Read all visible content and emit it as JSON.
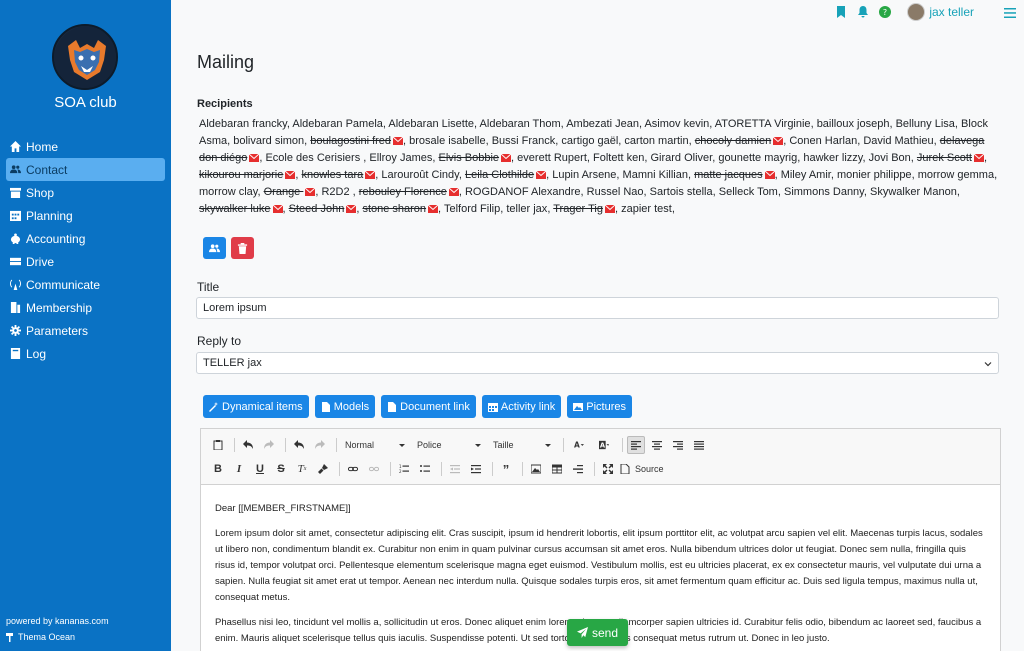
{
  "app": {
    "club_name": "SOA club",
    "powered_by": "powered by kananas.com",
    "theme": "Thema Ocean"
  },
  "sidebar": {
    "items": [
      {
        "label": "Home",
        "icon": "home-icon"
      },
      {
        "label": "Contact",
        "icon": "users-icon",
        "active": true
      },
      {
        "label": "Shop",
        "icon": "shop-icon"
      },
      {
        "label": "Planning",
        "icon": "calendar-icon"
      },
      {
        "label": "Accounting",
        "icon": "piggy-bank-icon"
      },
      {
        "label": "Drive",
        "icon": "drive-icon"
      },
      {
        "label": "Communicate",
        "icon": "broadcast-icon"
      },
      {
        "label": "Membership",
        "icon": "membership-icon"
      },
      {
        "label": "Parameters",
        "icon": "gear-icon"
      },
      {
        "label": "Log",
        "icon": "book-icon"
      }
    ]
  },
  "topbar": {
    "user_name": "jax teller"
  },
  "page": {
    "title": "Mailing"
  },
  "recipients": {
    "label": "Recipients",
    "list": [
      {
        "name": "Aldebaran francky"
      },
      {
        "name": "Aldebaran Pamela"
      },
      {
        "name": "Aldebaran Lisette"
      },
      {
        "name": "Aldebaran Thom"
      },
      {
        "name": "Ambezati Jean"
      },
      {
        "name": "Asimov kevin"
      },
      {
        "name": "ATORETTA Virginie"
      },
      {
        "name": "bailloux joseph"
      },
      {
        "name": "Belluny Lisa"
      },
      {
        "name": "Block Asma"
      },
      {
        "name": "bolivard simon"
      },
      {
        "name": "boulagostini fred",
        "invalid": true
      },
      {
        "name": "brosale isabelle"
      },
      {
        "name": "Bussi Franck"
      },
      {
        "name": "cartigo gaël"
      },
      {
        "name": "carton martin"
      },
      {
        "name": "chocoly damien",
        "invalid": true
      },
      {
        "name": "Conen Harlan"
      },
      {
        "name": "David Mathieu"
      },
      {
        "name": "delavega don diégo",
        "invalid": true
      },
      {
        "name": "Ecole des Cerisiers "
      },
      {
        "name": "Ellroy James"
      },
      {
        "name": "Elvis Bobbie",
        "invalid": true
      },
      {
        "name": "everett Rupert"
      },
      {
        "name": "Foltett ken"
      },
      {
        "name": "Girard Oliver"
      },
      {
        "name": "gounette mayrig"
      },
      {
        "name": "hawker lizzy"
      },
      {
        "name": "Jovi Bon"
      },
      {
        "name": "Jurek Scott",
        "invalid": true
      },
      {
        "name": "kikourou marjorie",
        "invalid": true
      },
      {
        "name": "knowles tara",
        "invalid": true
      },
      {
        "name": "Larouroût Cindy"
      },
      {
        "name": "Leila Clothilde",
        "invalid": true
      },
      {
        "name": "Lupin Arsene"
      },
      {
        "name": "Mamni Killian"
      },
      {
        "name": "matte jacques",
        "invalid": true
      },
      {
        "name": "Miley Amir"
      },
      {
        "name": "monier philippe"
      },
      {
        "name": "morrow gemma"
      },
      {
        "name": "morrow clay"
      },
      {
        "name": "Orange ",
        "invalid": true
      },
      {
        "name": "R2D2 "
      },
      {
        "name": "rebouley Florence",
        "invalid": true
      },
      {
        "name": "ROGDANOF Alexandre"
      },
      {
        "name": "Russel Nao"
      },
      {
        "name": "Sartois stella"
      },
      {
        "name": "Selleck Tom"
      },
      {
        "name": "Simmons Danny"
      },
      {
        "name": "Skywalker Manon"
      },
      {
        "name": "skywalker luke",
        "invalid": true
      },
      {
        "name": "Steed John",
        "invalid": true
      },
      {
        "name": "stone sharon",
        "invalid": true
      },
      {
        "name": "Telford Filip"
      },
      {
        "name": "teller jax"
      },
      {
        "name": "Trager Tig",
        "invalid": true
      },
      {
        "name": "zapier test"
      }
    ]
  },
  "form": {
    "title_label": "Title",
    "title_value": "Lorem ipsum",
    "reply_label": "Reply to",
    "reply_value": "TELLER jax"
  },
  "actions": {
    "dynamical": "Dynamical items",
    "models": "Models",
    "document_link": "Document link",
    "activity_link": "Activity link",
    "pictures": "Pictures"
  },
  "editor": {
    "format_select": "Normal",
    "font_select": "Police",
    "size_select": "Taille",
    "source_label": "Source",
    "greeting": "Dear [[MEMBER_FIRSTNAME]]",
    "paragraph1": "Lorem ipsum dolor sit amet, consectetur adipiscing elit. Cras suscipit, ipsum id hendrerit lobortis, elit ipsum porttitor elit, ac volutpat arcu sapien vel elit. Maecenas turpis lacus, sodales ut libero non, condimentum blandit ex. Curabitur non enim in quam pulvinar cursus accumsan sit amet eros. Nulla bibendum ultrices dolor ut feugiat. Donec sem nulla, fringilla quis risus id, tempor volutpat orci. Pellentesque elementum scelerisque magna eget euismod. Vestibulum mollis, est eu ultricies placerat, ex ex consectetur mauris, vel vulputate dui urna a sapien. Nulla feugiat sit amet erat ut tempor. Aenean nec interdum nulla. Quisque sodales turpis eros, sit amet fermentum quam efficitur ac. Duis sed ligula tempus, maximus nulla ut, consequat metus.",
    "paragraph2": "Phasellus nisi leo, tincidunt vel mollis a, sollicitudin ut eros. Donec aliquet enim lorem, sit amet ullamcorper sapien ultricies id. Curabitur felis odio, bibendum ac laoreet sed, faucibus a enim. Mauris aliquet scelerisque tellus quis iaculis. Suspendisse potenti. Ut sed tortor velit dui, quis consequat metus rutrum ut. Donec in leo justo."
  },
  "send_label": "send",
  "colors": {
    "sidebar": "#0a72c4",
    "primary": "#1a86e6",
    "danger": "#e03c48",
    "success": "#28a745",
    "accent": "#17a2b8"
  }
}
